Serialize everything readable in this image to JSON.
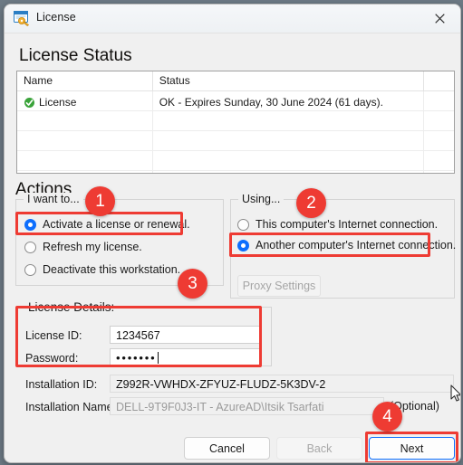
{
  "window": {
    "title": "License",
    "icon": "license-key-window-icon",
    "close_label": "✕"
  },
  "license_status": {
    "heading": "License Status",
    "columns": [
      "Name",
      "Status",
      ""
    ],
    "rows": [
      {
        "name": "License",
        "status": "OK - Expires Sunday, 30 June 2024 (61 days).",
        "icon": "green-check-icon"
      }
    ],
    "empty_row_count": 4
  },
  "actions": {
    "heading": "Actions",
    "want_to": {
      "legend": "I want to...",
      "options": [
        {
          "label": "Activate a license or renewal.",
          "selected": true
        },
        {
          "label": "Refresh my license.",
          "selected": false
        },
        {
          "label": "Deactivate this workstation.",
          "selected": false
        }
      ]
    },
    "using": {
      "legend": "Using...",
      "options": [
        {
          "label": "This computer's Internet connection.",
          "selected": false
        },
        {
          "label": "Another computer's Internet connection.",
          "selected": true
        }
      ],
      "proxy_button": "Proxy Settings"
    }
  },
  "license_details": {
    "legend": "License Details:",
    "license_id_label": "License ID:",
    "license_id_value": "1234567",
    "password_label": "Password:",
    "password_value": "•••••••"
  },
  "installation": {
    "id_label": "Installation ID:",
    "id_value": "Z992R-VWHDX-ZFYUZ-FLUDZ-5K3DV-2",
    "name_label": "Installation Name:",
    "name_value": "DELL-9T9F0J3-IT - AzureAD\\Itsik Tsarfati",
    "optional_label": "(Optional)"
  },
  "footer": {
    "cancel": "Cancel",
    "back": "Back",
    "next": "Next"
  },
  "annotations": {
    "badges": [
      "1",
      "2",
      "3",
      "4"
    ],
    "highlight_color": "#ee3b33"
  },
  "colors": {
    "accent": "#0d6efd",
    "dialog_bg": "#f0f0f0",
    "annotation_red": "#ee3b33",
    "ok_green": "#3aa33a"
  }
}
